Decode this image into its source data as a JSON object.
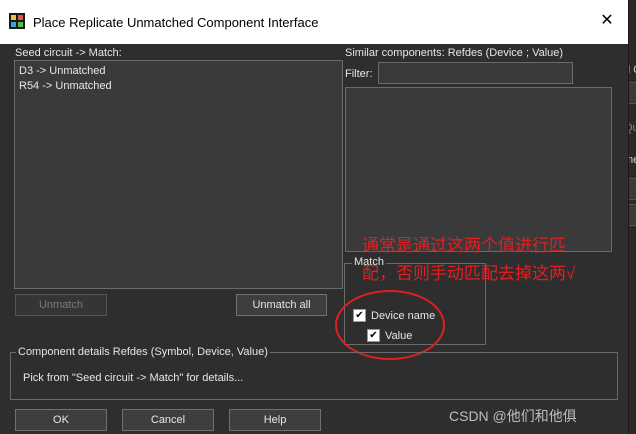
{
  "window": {
    "title": "Place Replicate Unmatched Component Interface",
    "close_glyph": "✕"
  },
  "seed": {
    "label": "Seed circuit -> Match:",
    "items": [
      "D3 -> Unmatched",
      "R54 -> Unmatched"
    ],
    "unmatch_label": "Unmatch",
    "unmatch_all_label": "Unmatch all"
  },
  "similar": {
    "label": "Similar components:  Refdes  (Device ; Value)",
    "filter_label": "Filter:",
    "filter_value": ""
  },
  "match": {
    "legend": "Match",
    "device_name_label": "Device name",
    "device_name_checked": true,
    "value_label": "Value",
    "value_checked": true,
    "check_glyph": "✔"
  },
  "details": {
    "legend": "Component details  Refdes (Symbol, Device, Value)",
    "text": "Pick from \"Seed circuit -> Match\" for details..."
  },
  "footer": {
    "ok_label": "OK",
    "cancel_label": "Cancel",
    "help_label": "Help"
  },
  "annotation": {
    "line1": "通常是通过这两个值进行匹",
    "line2": "配，否则手动匹配去掉这两√",
    "color": "#e02020"
  },
  "watermark": "CSDN @他们和他俱",
  "background_app": {
    "frag1": "d C",
    "frag2": "Qu",
    "frag3": "me",
    "frag4": "Ang"
  }
}
